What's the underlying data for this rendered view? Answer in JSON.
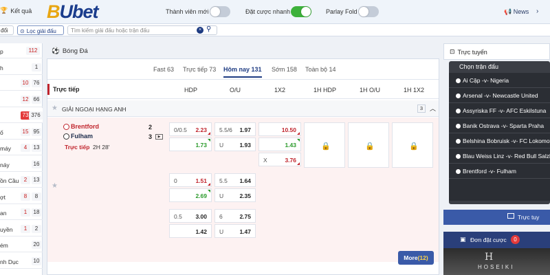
{
  "header": {
    "result_label": "Kết quả",
    "logo": "BUbet",
    "toggles": [
      {
        "label": "Thành viên mới",
        "on": false
      },
      {
        "label": "Đặt cược nhanh",
        "on": true
      },
      {
        "label": "Parlay Fold",
        "on": false
      }
    ],
    "news_label": "News"
  },
  "searchbar": {
    "left_stub": "đổi",
    "filter_label": "Lọc giải đấu",
    "placeholder": "Tìm kiếm giải đấu hoặc trận đấu"
  },
  "leftnav": [
    {
      "label": "p",
      "b1": "112",
      "b2": ""
    },
    {
      "label": "h",
      "b1": "",
      "b2": "1"
    },
    {
      "label": "",
      "b1": "10",
      "b2": "76"
    },
    {
      "label": "",
      "b1": "12",
      "b2": "66"
    },
    {
      "label": "",
      "b1": "73",
      "b2": "376"
    },
    {
      "label": "ố",
      "b1": "15",
      "b2": "95"
    },
    {
      "label": "máy",
      "b1": "4",
      "b2": "13"
    },
    {
      "label": "náy",
      "b1": "",
      "b2": "16"
    },
    {
      "label": "ồn Cầu",
      "b1": "2",
      "b2": "13"
    },
    {
      "label": "ợt",
      "b1": "8",
      "b2": "8"
    },
    {
      "label": "an",
      "b1": "1",
      "b2": "18"
    },
    {
      "label": "uyền",
      "b1": "1",
      "b2": "2"
    },
    {
      "label": "ém",
      "b1": "",
      "b2": "20"
    },
    {
      "label": "nh Dục",
      "b1": "",
      "b2": "10"
    }
  ],
  "main": {
    "sport_title": "Bóng Đá",
    "tabs": [
      {
        "label": "Fast 63",
        "active": false
      },
      {
        "label": "Trực tiếp 73",
        "active": false
      },
      {
        "label": "Hôm nay 131",
        "active": true
      },
      {
        "label": "Sớm 158",
        "active": false
      },
      {
        "label": "Toàn bộ 14",
        "active": false
      }
    ],
    "col_live": "Trực tiếp",
    "columns": [
      "HDP",
      "O/U",
      "1X2",
      "1H HDP",
      "1H O/U",
      "1H 1X2"
    ],
    "league": {
      "name": "GIẢI NGOẠI HẠNG ANH",
      "count": "3"
    },
    "match": {
      "home": "Brentford",
      "away": "Fulham",
      "home_score": "2",
      "away_score": "3",
      "status": "Trực tiếp",
      "time": "2H 28'"
    },
    "odds": {
      "r1_hdp_line": "0/0.5",
      "r1_hdp_home": "2.23",
      "r1_hdp_away": "1.73",
      "r1_ou_line": "5.5/6",
      "r1_ou_over": "1.97",
      "r1_ou_u": "U",
      "r1_ou_under": "1.93",
      "r1_1x2_1": "10.50",
      "r1_1x2_2": "1.43",
      "r1_1x2_x": "X",
      "r1_1x2_xv": "3.76",
      "r2_hdp_line": "0",
      "r2_hdp_home": "1.51",
      "r2_hdp_away": "2.69",
      "r2_ou_line": "5.5",
      "r2_ou_over": "1.64",
      "r2_ou_u": "U",
      "r2_ou_under": "2.35",
      "r3_hdp_line": "0.5",
      "r3_hdp_home": "3.00",
      "r3_hdp_away": "1.42",
      "r3_ou_line": "6",
      "r3_ou_over": "2.75",
      "r3_ou_u": "U",
      "r3_ou_under": "1.47"
    },
    "more_label": "More",
    "more_count": "(12)"
  },
  "right": {
    "live_title": "Trực tuyến",
    "select_caption": "Chọn trận đấu",
    "matches": [
      "Ai Cập -v- Nigeria",
      "Arsenal -v- Newcastle United",
      "Assyriska FF -v- AFC Eskilstuna",
      "Banik Ostrava -v- Sparta Praha",
      "Belshina Bobruisk -v- FC Lokomotiv",
      "Blau Weiss Linz -v- Red Bull Salzburg",
      "Brentford -v- Fulham"
    ],
    "tv_label": "Trực tuy",
    "bet_label": "Đơn đặt cược",
    "bet_count": "0",
    "ad_text": "HOSEIKI"
  },
  "colors": {
    "brand": "#1d3b82",
    "accent": "#e8a612",
    "live_red": "#c0242c",
    "odd_green": "#2a9a2a"
  }
}
